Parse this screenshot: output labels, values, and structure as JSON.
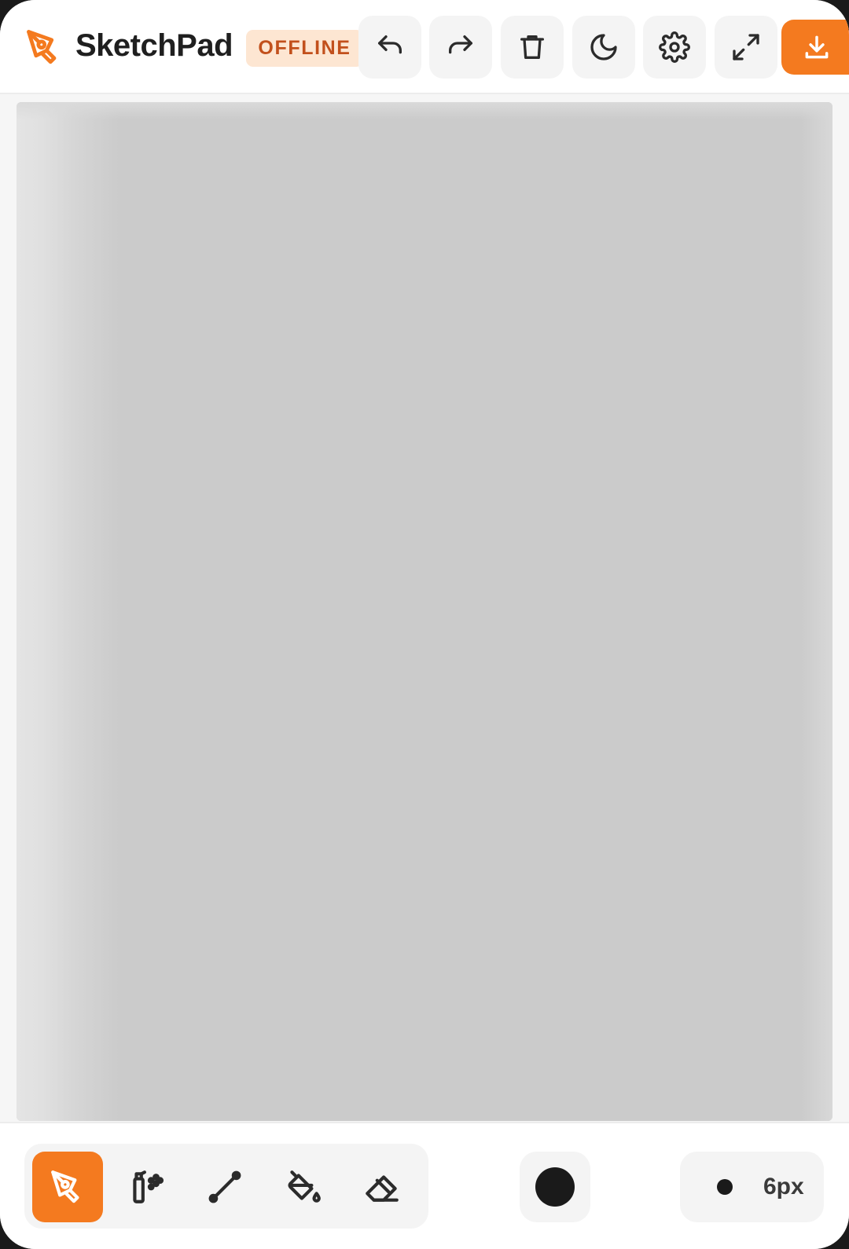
{
  "header": {
    "app_title": "SketchPad",
    "status_badge": "OFFLINE",
    "logo_icon": "pen-nib-icon",
    "buttons": [
      {
        "name": "undo",
        "icon": "undo-icon"
      },
      {
        "name": "redo",
        "icon": "redo-icon"
      },
      {
        "name": "clear",
        "icon": "trash-icon"
      },
      {
        "name": "dark-mode",
        "icon": "moon-icon"
      },
      {
        "name": "settings",
        "icon": "gear-icon"
      },
      {
        "name": "fullscreen",
        "icon": "expand-icon"
      },
      {
        "name": "download",
        "icon": "download-icon"
      }
    ]
  },
  "toolbar": {
    "tools": [
      {
        "name": "pen",
        "icon": "pen-nib-icon",
        "active": true
      },
      {
        "name": "spray",
        "icon": "spray-can-icon",
        "active": false
      },
      {
        "name": "line",
        "icon": "line-icon",
        "active": false
      },
      {
        "name": "fill",
        "icon": "paint-bucket-icon",
        "active": false
      },
      {
        "name": "eraser",
        "icon": "eraser-icon",
        "active": false
      }
    ],
    "current_color": "#1a1a1a",
    "brush_size_label": "6px"
  },
  "colors": {
    "accent": "#f47a1f",
    "badge_bg": "#fde6d2",
    "badge_text": "#c2501c",
    "canvas": "#cbcbcb"
  }
}
